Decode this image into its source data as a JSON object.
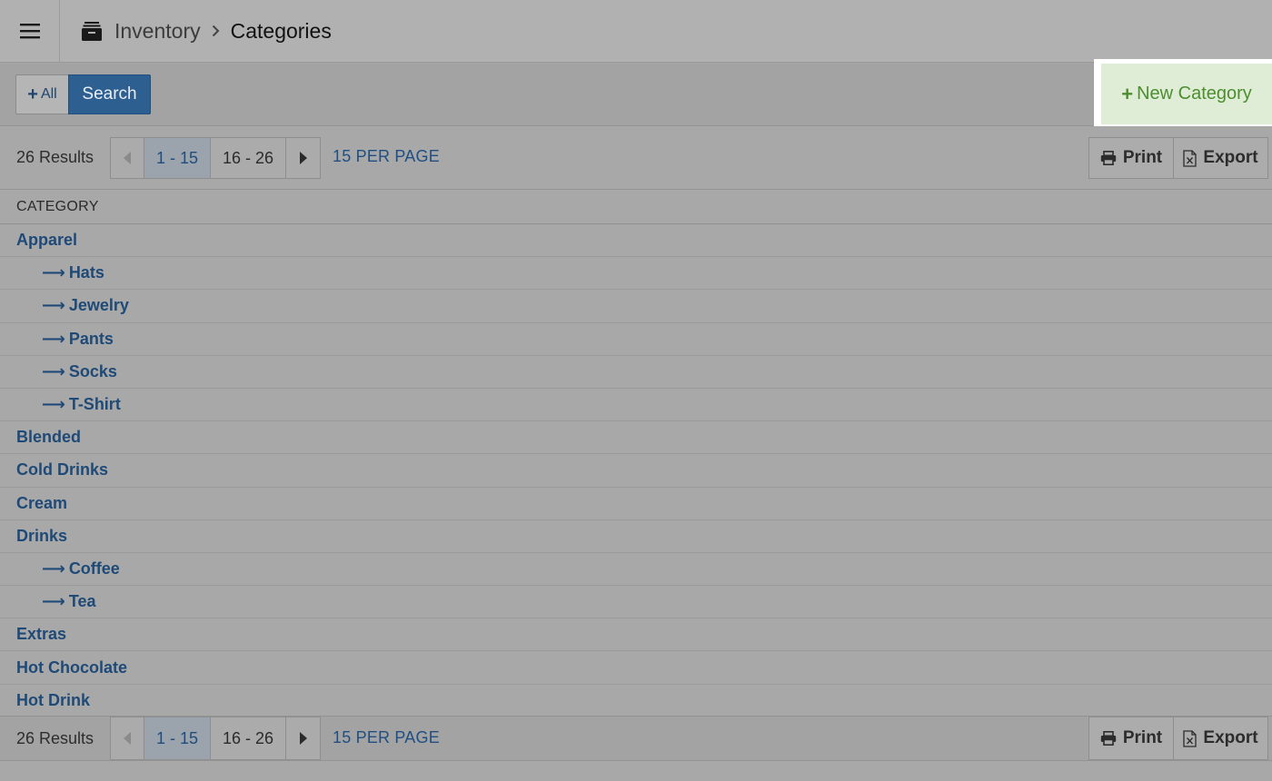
{
  "header": {
    "breadcrumb_root": "Inventory",
    "breadcrumb_current": "Categories"
  },
  "toolbar": {
    "all_label": "All",
    "search_label": "Search",
    "new_category_label": "New Category"
  },
  "pagination": {
    "results": "26 Results",
    "pages": [
      "1 - 15",
      "16 - 26"
    ],
    "per_page": "15 PER PAGE",
    "print_label": "Print",
    "export_label": "Export"
  },
  "table": {
    "column_header": "CATEGORY",
    "rows": [
      {
        "label": "Apparel",
        "child": false
      },
      {
        "label": "Hats",
        "child": true
      },
      {
        "label": "Jewelry",
        "child": true
      },
      {
        "label": "Pants",
        "child": true
      },
      {
        "label": "Socks",
        "child": true
      },
      {
        "label": "T-Shirt",
        "child": true
      },
      {
        "label": "Blended",
        "child": false
      },
      {
        "label": "Cold Drinks",
        "child": false
      },
      {
        "label": "Cream",
        "child": false
      },
      {
        "label": "Drinks",
        "child": false
      },
      {
        "label": "Coffee",
        "child": true
      },
      {
        "label": "Tea",
        "child": true
      },
      {
        "label": "Extras",
        "child": false
      },
      {
        "label": "Hot Chocolate",
        "child": false
      },
      {
        "label": "Hot Drink",
        "child": false
      }
    ]
  },
  "colors": {
    "link": "#1f4a77",
    "primary_button": "#2e5f91",
    "new_button_bg": "#dfedd6",
    "new_button_text": "#4c8e2f"
  }
}
